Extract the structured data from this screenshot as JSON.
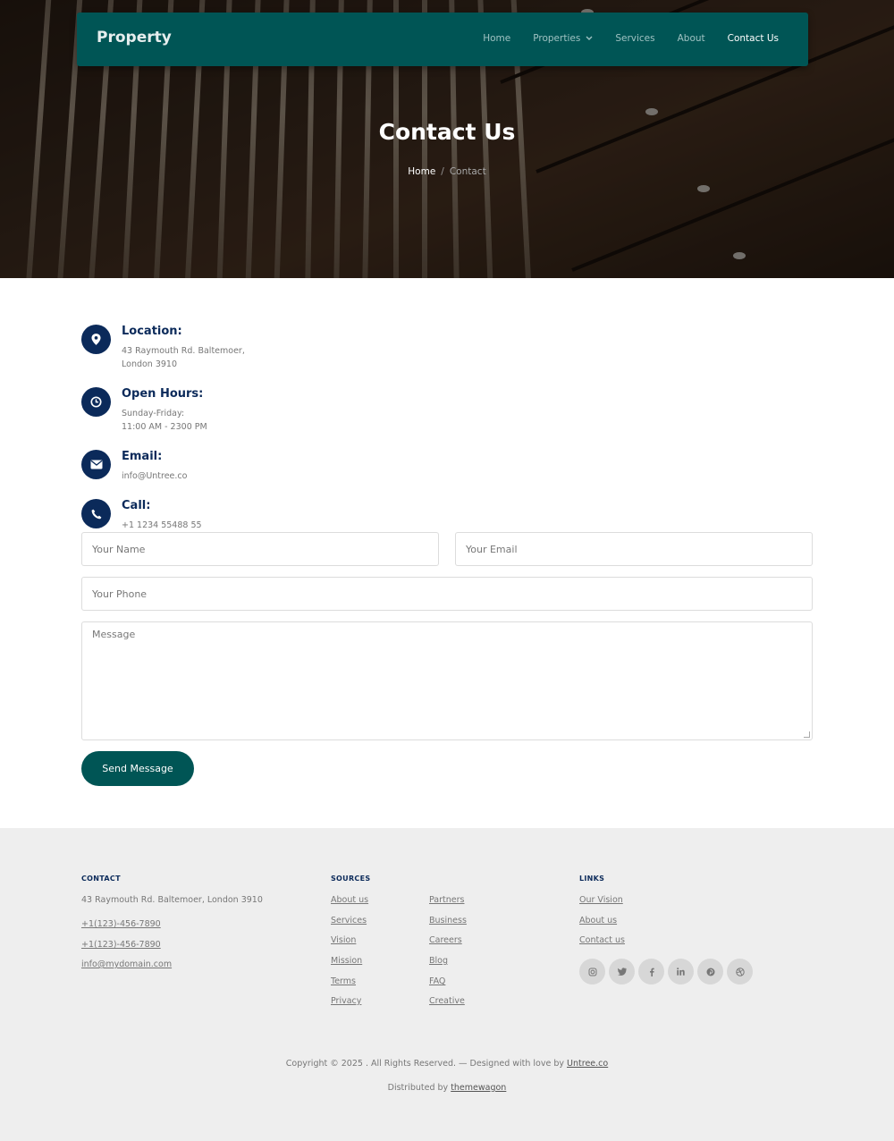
{
  "nav": {
    "brand": "Property",
    "items": [
      {
        "label": "Home",
        "active": false
      },
      {
        "label": "Properties",
        "active": false,
        "dropdown": true
      },
      {
        "label": "Services",
        "active": false
      },
      {
        "label": "About",
        "active": false
      },
      {
        "label": "Contact Us",
        "active": true
      }
    ]
  },
  "hero": {
    "title": "Contact Us",
    "breadcrumb": {
      "home": "Home",
      "separator": "/",
      "current": "Contact"
    }
  },
  "info": {
    "location": {
      "title": "Location:",
      "line1": "43 Raymouth Rd. Baltemoer,",
      "line2": "London 3910",
      "icon": "map-pin-icon"
    },
    "hours": {
      "title": "Open Hours:",
      "line1": "Sunday-Friday:",
      "line2": "11:00 AM - 2300 PM",
      "icon": "clock-icon"
    },
    "email": {
      "title": "Email:",
      "line1": "info@Untree.co",
      "icon": "envelope-icon"
    },
    "call": {
      "title": "Call:",
      "line1": "+1 1234 55488 55",
      "icon": "phone-icon"
    }
  },
  "form": {
    "name_placeholder": "Your Name",
    "email_placeholder": "Your Email",
    "phone_placeholder": "Your Phone",
    "message_placeholder": "Message",
    "submit_label": "Send Message"
  },
  "footer": {
    "contact": {
      "heading": "CONTACT",
      "address": "43 Raymouth Rd. Baltemoer, London 3910",
      "phone1": "+1(123)-456-7890",
      "phone2": "+1(123)-456-7890",
      "email": "info@mydomain.com"
    },
    "sources": {
      "heading": "SOURCES",
      "col1": [
        "About us",
        "Services",
        "Vision",
        "Mission",
        "Terms",
        "Privacy"
      ],
      "col2": [
        "Partners",
        "Business",
        "Careers",
        "Blog",
        "FAQ",
        "Creative"
      ]
    },
    "links": {
      "heading": "LINKS",
      "items": [
        "Our Vision",
        "About us",
        "Contact us"
      ],
      "social": [
        "instagram-icon",
        "twitter-icon",
        "facebook-icon",
        "linkedin-icon",
        "pinterest-icon",
        "dribbble-icon"
      ]
    },
    "copyright": "Copyright © 2025 . All Rights Reserved. — Designed with love by",
    "copyright_link": "Untree.co",
    "distributed": "Distributed by",
    "distributed_link": "themewagon"
  },
  "colors": {
    "primary": "#005555",
    "navy": "#0b2a5a",
    "footer_bg": "#eeeeee"
  }
}
